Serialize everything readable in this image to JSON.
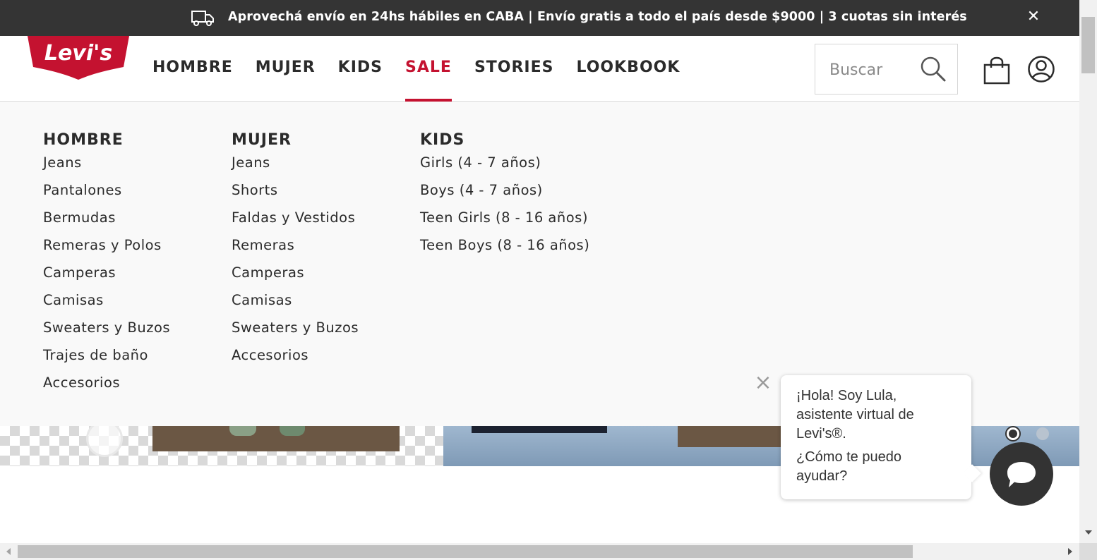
{
  "promo": {
    "text": "Aprovechá envío en 24hs hábiles en CABA | Envío gratis a todo el país desde $9000 | 3 cuotas sin interés",
    "close_label": "✕"
  },
  "header": {
    "logo_text": "Levi's",
    "nav": [
      "HOMBRE",
      "MUJER",
      "KIDS",
      "SALE",
      "STORIES",
      "LOOKBOOK"
    ],
    "active_nav": "SALE",
    "search_placeholder": "Buscar"
  },
  "mega_menu": {
    "columns": [
      {
        "title": "HOMBRE",
        "items": [
          "Jeans",
          "Pantalones",
          "Bermudas",
          "Remeras y Polos",
          "Camperas",
          "Camisas",
          "Sweaters y Buzos",
          "Trajes de baño",
          "Accesorios"
        ]
      },
      {
        "title": "MUJER",
        "items": [
          "Jeans",
          "Shorts",
          "Faldas y Vestidos",
          "Remeras",
          "Camperas",
          "Camisas",
          "Sweaters y Buzos",
          "Accesorios"
        ]
      },
      {
        "title": "KIDS",
        "items": [
          "Girls (4 - 7 años)",
          "Boys (4 - 7 años)",
          "Teen Girls (8 - 16 años)",
          "Teen Boys (8 - 16 años)"
        ]
      }
    ]
  },
  "chat": {
    "close_label": "×",
    "greeting": "¡Hola! Soy Lula, asistente virtual de Levi's®.",
    "question": "¿Cómo te puedo ayudar?"
  },
  "colors": {
    "brand_red": "#c41230",
    "promo_bg": "#343434",
    "menu_bg": "#f9f9f9"
  }
}
